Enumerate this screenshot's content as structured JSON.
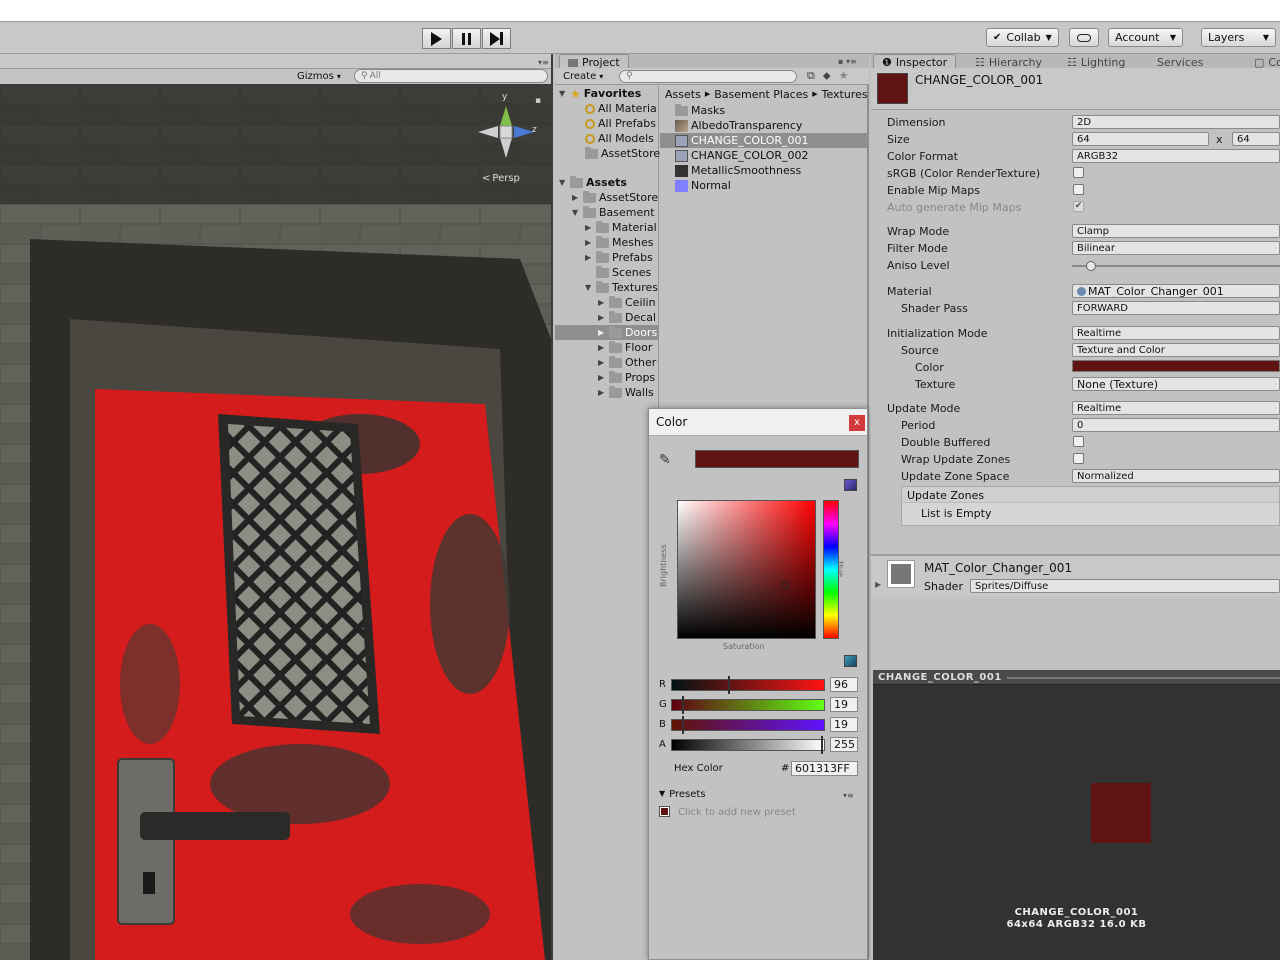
{
  "toolbar": {
    "collab": "Collab",
    "account": "Account",
    "layers": "Layers"
  },
  "scene": {
    "gizmos": "Gizmos",
    "search_placeholder": "All",
    "persp": "Persp",
    "gizmo_axes": {
      "y": "y",
      "z": "z"
    }
  },
  "project": {
    "tab": "Project",
    "create": "Create",
    "favorites": {
      "label": "Favorites",
      "items": [
        "All Materia",
        "All Prefabs",
        "All Models",
        "AssetStore"
      ]
    },
    "assets": {
      "label": "Assets",
      "items": [
        "AssetStore",
        "Basement",
        "Material",
        "Meshes",
        "Prefabs",
        "Scenes",
        "Textures",
        "Ceilin",
        "Decal",
        "Doors",
        "Floor",
        "Other",
        "Props",
        "Walls"
      ]
    },
    "breadcrumb": [
      "Assets",
      "Basement Places",
      "Textures"
    ],
    "files": [
      "Masks",
      "AlbedoTransparency",
      "CHANGE_COLOR_001",
      "CHANGE_COLOR_002",
      "MetallicSmoothness",
      "Normal"
    ]
  },
  "color_picker": {
    "title": "Color",
    "close": "x",
    "brightness_label": "Brightness",
    "hue_label": "Hue",
    "saturation_label": "Saturation",
    "channels": [
      {
        "name": "R",
        "value": "96"
      },
      {
        "name": "G",
        "value": "19"
      },
      {
        "name": "B",
        "value": "19"
      },
      {
        "name": "A",
        "value": "255"
      }
    ],
    "hex_label": "Hex Color",
    "hex_hash": "#",
    "hex_value": "601313FF",
    "presets_label": "Presets",
    "preset_hint": "Click to add new preset",
    "current_color": "#601313"
  },
  "inspector": {
    "tabs": [
      "Inspector",
      "Hierarchy",
      "Lighting",
      "Services",
      "Co"
    ],
    "asset_name": "CHANGE_COLOR_001",
    "props": {
      "dimension": {
        "label": "Dimension",
        "value": "2D"
      },
      "size": {
        "label": "Size",
        "w": "64",
        "x": "x",
        "h": "64"
      },
      "color_format": {
        "label": "Color Format",
        "value": "ARGB32"
      },
      "srgb": {
        "label": "sRGB (Color RenderTexture)"
      },
      "mipmaps": {
        "label": "Enable Mip Maps"
      },
      "auto_mip": {
        "label": "Auto generate Mip Maps"
      },
      "wrap_mode": {
        "label": "Wrap Mode",
        "value": "Clamp"
      },
      "filter_mode": {
        "label": "Filter Mode",
        "value": "Bilinear"
      },
      "aniso": {
        "label": "Aniso Level"
      },
      "material": {
        "label": "Material",
        "value": "MAT_Color_Changer_001"
      },
      "shader_pass": {
        "label": "Shader Pass",
        "value": "FORWARD"
      },
      "init_mode": {
        "label": "Initialization Mode",
        "value": "Realtime"
      },
      "source": {
        "label": "Source",
        "value": "Texture and Color"
      },
      "color": {
        "label": "Color"
      },
      "texture": {
        "label": "Texture",
        "value": "None (Texture)"
      },
      "update_mode": {
        "label": "Update Mode",
        "value": "Realtime"
      },
      "period": {
        "label": "Period",
        "value": "0"
      },
      "double_buffered": {
        "label": "Double Buffered"
      },
      "wrap_zones": {
        "label": "Wrap Update Zones"
      },
      "zone_space": {
        "label": "Update Zone Space",
        "value": "Normalized"
      },
      "update_zones": {
        "label": "Update Zones",
        "empty": "List is Empty"
      }
    },
    "material_section": {
      "name": "MAT_Color_Changer_001",
      "shader_label": "Shader",
      "shader_value": "Sprites/Diffuse"
    },
    "preview": {
      "header": "CHANGE_COLOR_001",
      "caption_name": "CHANGE_COLOR_001",
      "caption_info": "64x64  ARGB32  16.0 KB"
    }
  }
}
